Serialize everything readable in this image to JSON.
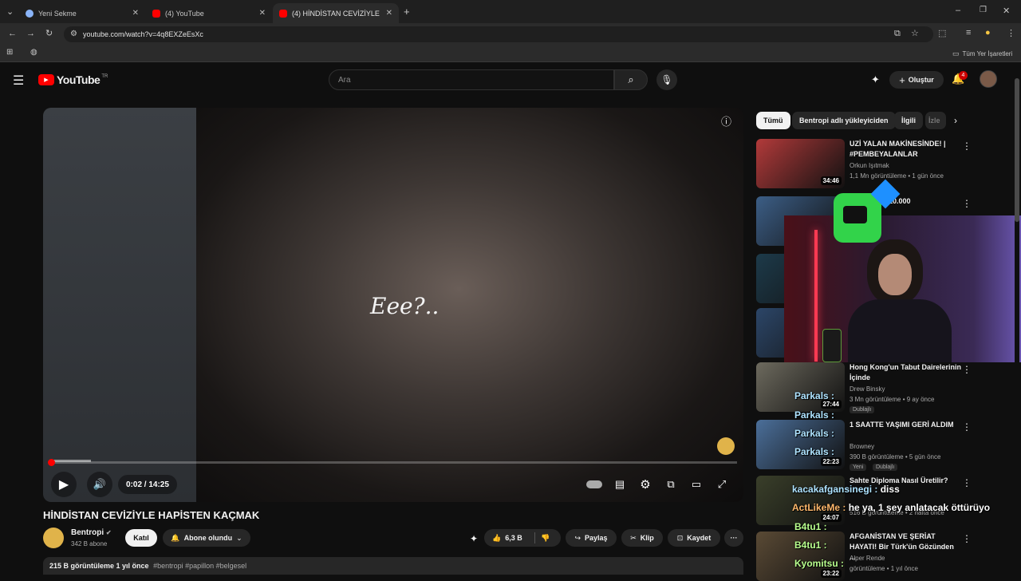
{
  "browser": {
    "tabs": [
      {
        "label": "Yeni Sekme"
      },
      {
        "label": "(4) YouTube"
      },
      {
        "label": "(4) HİNDİSTAN CEVİZİYLE HAPİ"
      }
    ],
    "url": "youtube.com/watch?v=4q8EXZeEsXc",
    "bookmarks_all": "Tüm Yer İşaretleri"
  },
  "youtube": {
    "logo": "YouTube",
    "region": "TR",
    "search_placeholder": "Ara",
    "create_label": "Oluştur",
    "notif_count": "4"
  },
  "player": {
    "subtitle": "Eee?..",
    "time": "0:02 / 14:25",
    "progress": 0.0023
  },
  "video": {
    "title": "HİNDİSTAN CEVİZİYLE HAPİSTEN KAÇMAK",
    "channel": "Bentropi",
    "subs": "342 B abone",
    "join_label": "Katıl",
    "subscribed_label": "Abone olundu",
    "likes": "6,3 B",
    "share_label": "Paylaş",
    "clip_label": "Klip",
    "save_label": "Kaydet",
    "desc_stats": "215 B görüntüleme  1 yıl önce",
    "hashtags": "#bentropi #papillon #belgesel"
  },
  "chips": [
    "Tümü",
    "Bentropi adlı yükleyiciden",
    "İlgili",
    "İzle"
  ],
  "recs": [
    {
      "title": "UZİ YALAN MAKİNESİNDE! | #PEMBEYALANLAR",
      "channel": "Orkun Işıtmak",
      "meta": "1,1 Mn görüntüleme • 1 gün önce",
      "duration": "34:46",
      "thumb_color": "#b23a3a"
    },
    {
      "title": "Patron İçin 10.000",
      "channel": "",
      "meta": "",
      "duration": "",
      "thumb_color": "#3c5e86"
    },
    {
      "title": "",
      "channel": "",
      "meta": "",
      "duration": "",
      "thumb_color": "#1d3a4a"
    },
    {
      "title": "",
      "channel": "",
      "meta": "",
      "duration": "",
      "thumb_color": "#2c4668"
    },
    {
      "title": "Hong Kong'un Tabut Dairelerinin İçinde",
      "channel": "Drew Binsky",
      "meta": "3 Mn görüntüleme • 9 ay önce",
      "duration": "27:44",
      "badge": "Dublajlı",
      "thumb_color": "#6d6a5e"
    },
    {
      "title": "1 SAATTE YAŞIMI GERİ ALDIM",
      "channel": "Browney",
      "meta": "390 B görüntüleme • 5 gün önce",
      "duration": "22:23",
      "badge": "Dublajlı",
      "badge2": "Yeni",
      "thumb_color": "#4b6f9a"
    },
    {
      "title": "Sahte Diploma Nasıl Üretilir?",
      "channel": "",
      "meta": "516 B görüntüleme • 2 hafta önce",
      "duration": "24:07",
      "thumb_color": "#3a3f2a"
    },
    {
      "title": "AFGANİSTAN VE ŞERİAT HAYATI! Bir Türk'ün Gözünden ...",
      "channel": "Alper Rende",
      "meta": "görüntüleme • 1 yıl önce",
      "duration": "23:22",
      "thumb_color": "#5a4a35"
    }
  ],
  "overlay_chat": [
    {
      "user": "Parkals :",
      "msg": ""
    },
    {
      "user": "Parkals :",
      "msg": ""
    },
    {
      "user": "Parkals :",
      "msg": ""
    },
    {
      "user": "Parkals :",
      "msg": ""
    },
    {
      "user": "kacakafgansinegi :",
      "msg": "diss"
    },
    {
      "user": "ActLikeMe :",
      "msg": "he ya, 1 şey anlatacak öttürüyo"
    },
    {
      "user": "B4tu1 :",
      "msg": ""
    },
    {
      "user": "B4tu1 :",
      "msg": ""
    },
    {
      "user": "Kyomitsu :",
      "msg": ""
    }
  ],
  "colors": {
    "yt_red": "#ff0000",
    "bg": "#0f0f0f",
    "chip": "#272727"
  }
}
